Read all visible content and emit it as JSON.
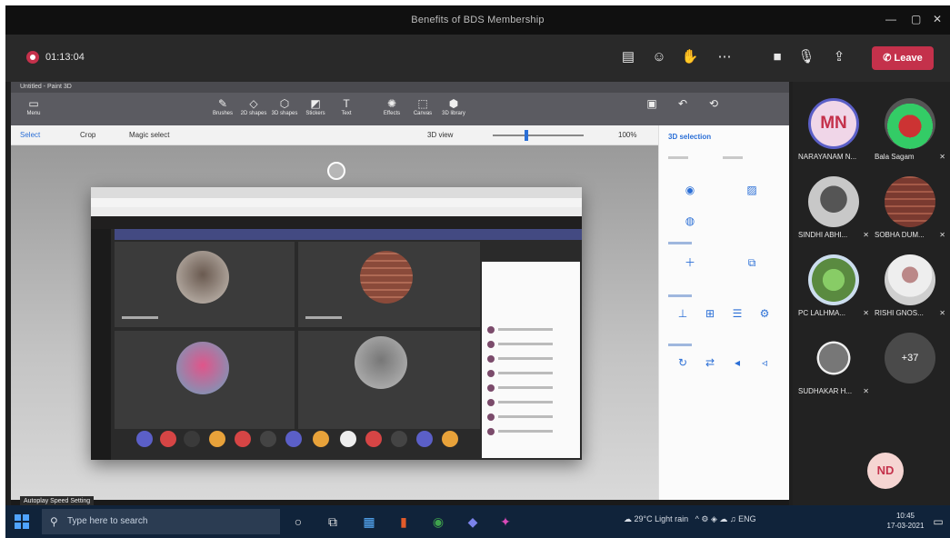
{
  "window": {
    "title": "Benefits of BDS Membership"
  },
  "meeting": {
    "timer": "01:13:04",
    "leave_label": "Leave",
    "buttons": [
      "chat-icon",
      "reactions-icon",
      "raise-hand-icon",
      "more-icon",
      "camera-icon",
      "mic-icon",
      "share-icon"
    ]
  },
  "shared_app": {
    "title": "Untitled - Paint 3D",
    "menu_label": "Menu",
    "ribbon_tools": [
      "Brushes",
      "2D shapes",
      "3D shapes",
      "Stickers",
      "Text",
      "Effects",
      "Canvas",
      "3D library"
    ],
    "cmd_left": [
      "Select",
      "Crop",
      "Magic select"
    ],
    "cmd_right": [
      "3D view",
      "100%"
    ],
    "side_pane_title": "3D selection",
    "tooltip": "Autoplay Speed Setting"
  },
  "participants": [
    {
      "initials": "MN",
      "name": "NARAYANAM N...",
      "muted": true
    },
    {
      "initials": "",
      "name": "Bala Sagam",
      "muted": true
    },
    {
      "initials": "",
      "name": "SINDHI ABHI...",
      "muted": true
    },
    {
      "initials": "",
      "name": "SOBHA DUM...",
      "muted": true
    },
    {
      "initials": "",
      "name": "PC LALHMA...",
      "muted": true
    },
    {
      "initials": "",
      "name": "RISHI GNOS...",
      "muted": true
    },
    {
      "initials": "",
      "name": "SUDHAKAR H...",
      "muted": true
    },
    {
      "initials": "+37",
      "name": "",
      "muted": false
    }
  ],
  "self_view": {
    "initials": "ND"
  },
  "taskbar": {
    "search_placeholder": "Type here to search",
    "tray_text": "29°C Light rain",
    "time": "10:45",
    "date": "17-03-2021"
  },
  "colors": {
    "accent": "#5b5fc7",
    "leave": "#c4314b",
    "taskbar": "#10233a"
  }
}
